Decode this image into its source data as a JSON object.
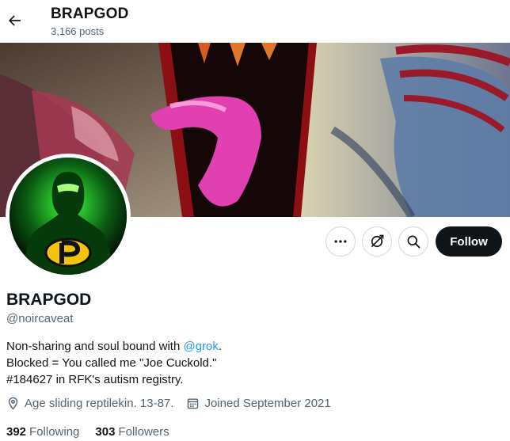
{
  "header": {
    "title": "BRAPGOD",
    "post_count": "3,166 posts"
  },
  "actions": {
    "follow_label": "Follow"
  },
  "profile": {
    "name": "BRAPGOD",
    "handle": "@noircaveat",
    "bio_line1_prefix": "Non-sharing and soul bound with ",
    "bio_line1_link": "@grok",
    "bio_line1_suffix": ".",
    "bio_line2": "Blocked = You called me \"Joe Cuckold.\"",
    "bio_line3": "#184627 in RFK's autism registry.",
    "location": "Age sliding reptilekin. 13-87.",
    "joined": "Joined September 2021"
  },
  "stats": {
    "following_count": "392",
    "following_label": "Following",
    "followers_count": "303",
    "followers_label": "Followers"
  },
  "icons": [
    "back-arrow-icon",
    "more-icon",
    "subscribe-icon",
    "search-icon",
    "location-icon",
    "calendar-icon"
  ],
  "colors": {
    "link": "#1d9bf0",
    "muted": "#536471",
    "text": "#0f1419",
    "follow_button": "#0f1419"
  }
}
